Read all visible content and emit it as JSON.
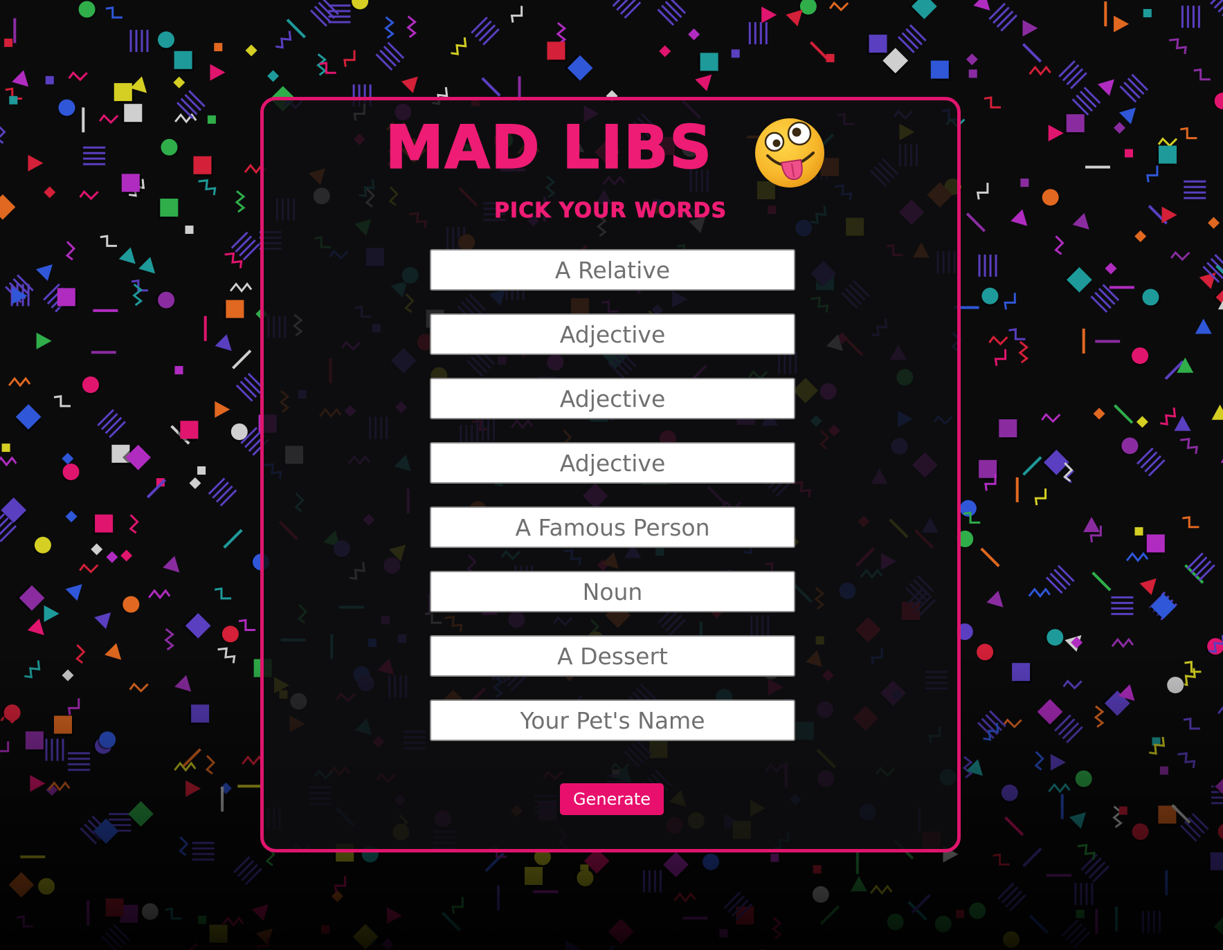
{
  "app": {
    "title": "MAD LIBS",
    "subtitle": "PICK YOUR WORDS"
  },
  "fields": [
    {
      "placeholder": "A Relative"
    },
    {
      "placeholder": "Adjective"
    },
    {
      "placeholder": "Adjective"
    },
    {
      "placeholder": "Adjective"
    },
    {
      "placeholder": "A Famous Person"
    },
    {
      "placeholder": "Noun"
    },
    {
      "placeholder": "A Dessert"
    },
    {
      "placeholder": "Your Pet's Name"
    }
  ],
  "actions": {
    "generate_label": "Generate"
  },
  "colors": {
    "accent": "#e8106c",
    "background": "#0b0b0c",
    "confetti": [
      "#e0156e",
      "#1e9a9a",
      "#d4cf22",
      "#5a3fc0",
      "#2f57d8",
      "#e06820",
      "#2fae4a",
      "#d42038",
      "#cfcfcf",
      "#b02cc0",
      "#8a2ca0"
    ]
  },
  "icons": {
    "title_emoji": "zany-face-icon"
  }
}
